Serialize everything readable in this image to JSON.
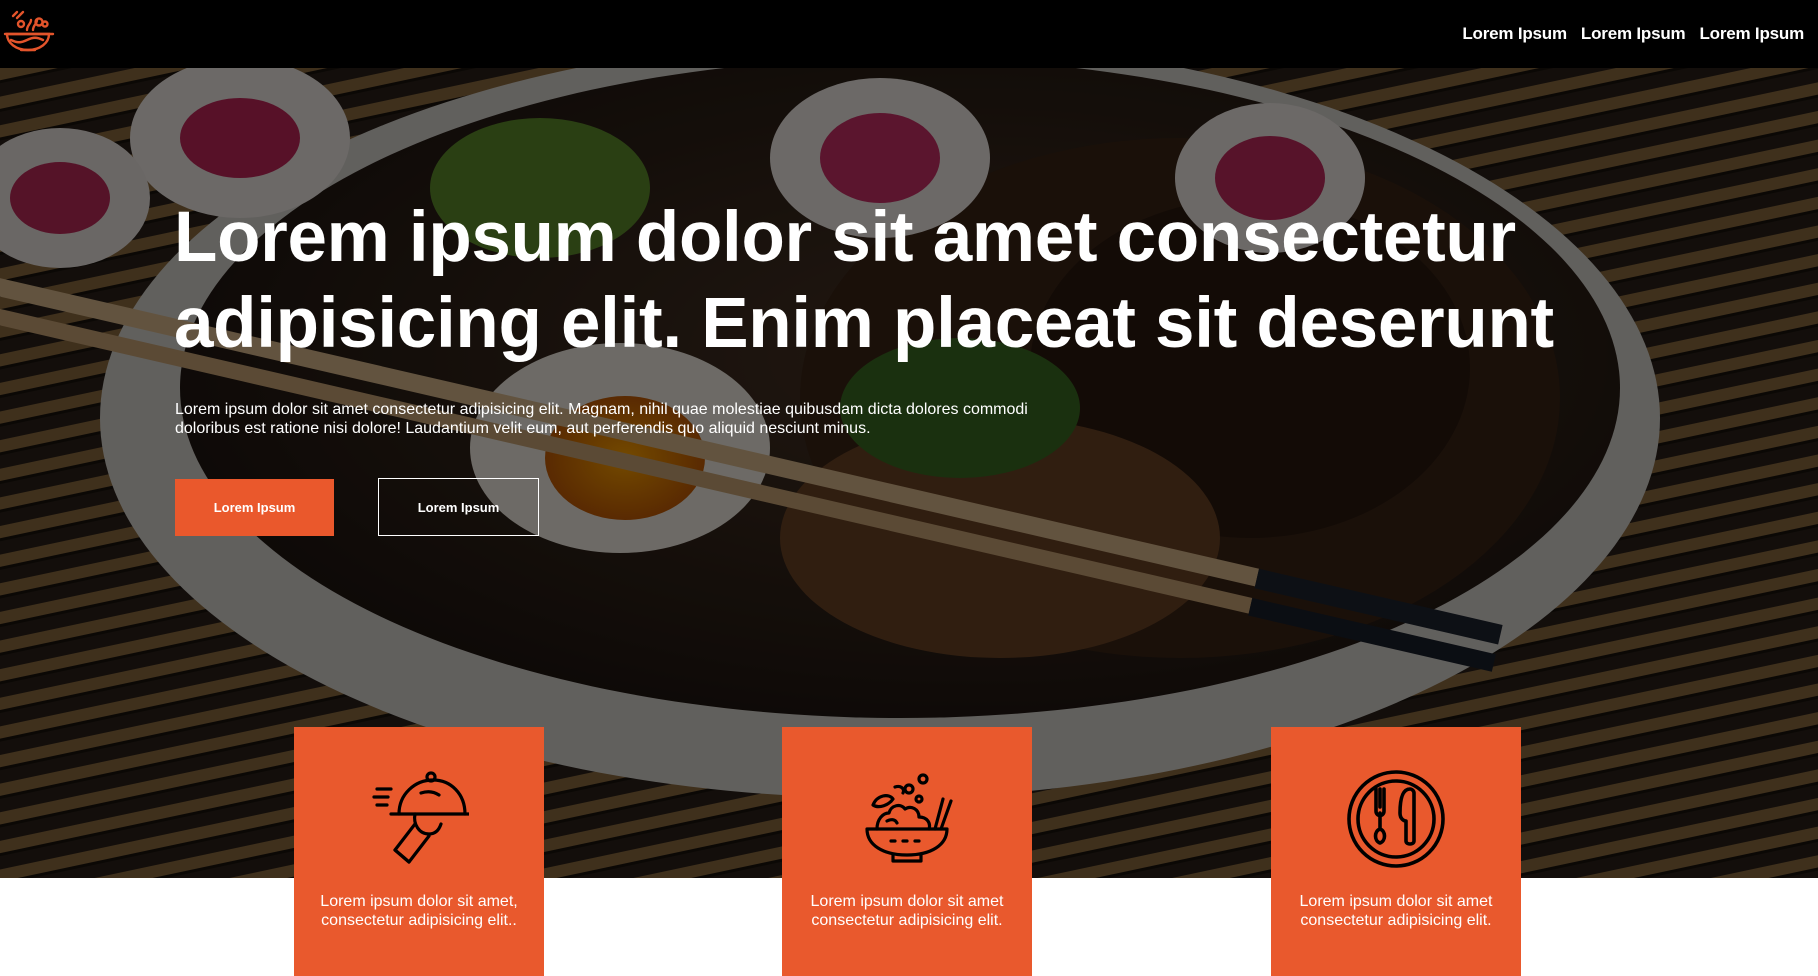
{
  "nav": {
    "logo_icon": "ramen-bowl-icon",
    "links": [
      "Lorem Ipsum",
      "Lorem Ipsum",
      "Lorem Ipsum"
    ]
  },
  "hero": {
    "title": "Lorem ipsum dolor sit amet consectetur adipisicing elit. Enim placeat sit deserunt",
    "text": "Lorem ipsum dolor sit amet consectetur adipisicing elit. Magnam, nihil quae molestiae quibusdam dicta dolores commodi doloribus est ratione nisi dolore! Laudantium velit eum, aut perferendis quo aliquid nesciunt minus.",
    "primary_button": "Lorem Ipsum",
    "secondary_button": "Lorem Ipsum"
  },
  "features": [
    {
      "icon": "food-delivery-cloche-icon",
      "text": "Lorem ipsum dolor sit amet, consectetur adipisicing elit.."
    },
    {
      "icon": "salad-bowl-icon",
      "text": "Lorem ipsum dolor sit amet consectetur adipisicing elit."
    },
    {
      "icon": "fork-knife-plate-icon",
      "text": "Lorem ipsum dolor sit amet consectetur adipisicing elit."
    }
  ],
  "colors": {
    "accent": "#ea582c",
    "navbar": "#000000",
    "text_light": "#ffffff"
  }
}
